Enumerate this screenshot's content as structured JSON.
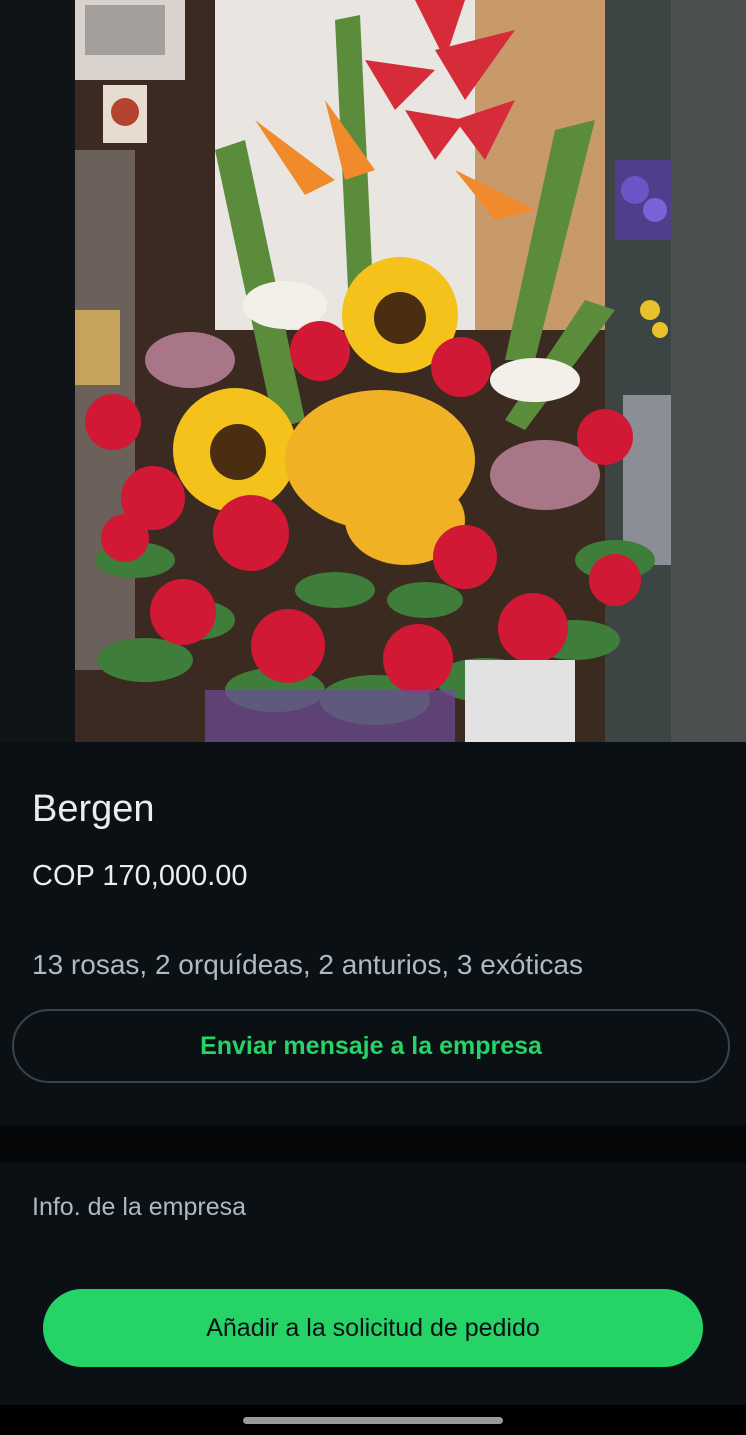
{
  "product": {
    "name": "Bergen",
    "price": "COP 170,000.00",
    "description": "13 rosas, 2 orquídeas, 2 anturios, 3 exóticas"
  },
  "actions": {
    "message_label": "Enviar mensaje a la empresa",
    "add_label": "Añadir a la solicitud de pedido"
  },
  "business": {
    "info_label": "Info. de la empresa"
  },
  "colors": {
    "accent": "#25d366",
    "background": "#0b1014",
    "primary_text": "#e9edef",
    "secondary_text": "#aebac1"
  }
}
